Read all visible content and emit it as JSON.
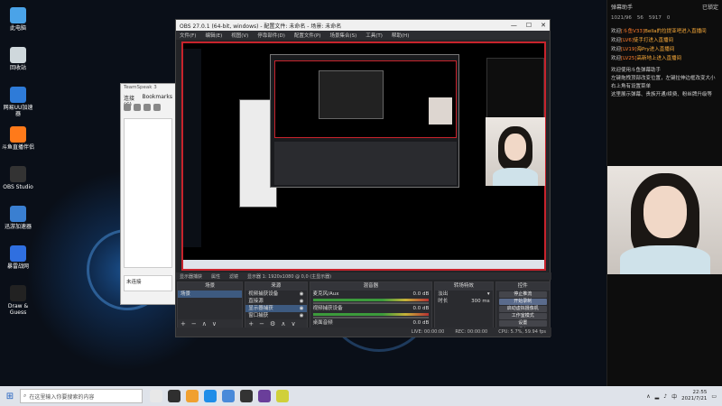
{
  "desktop": {
    "icons": [
      {
        "name": "此电脑",
        "color": "#4aa3e8"
      },
      {
        "name": "回收站",
        "color": "#cfd8dc"
      },
      {
        "name": "网易UU加速器",
        "color": "#2e7bd8"
      },
      {
        "name": "斗鱼直播伴侣",
        "color": "#ff7a1a"
      },
      {
        "name": "OBS Studio",
        "color": "#333333"
      },
      {
        "name": "迅游加速器",
        "color": "#3a7fd1"
      },
      {
        "name": "暴雷战网",
        "color": "#2f6fe0"
      },
      {
        "name": "Draw & Guess",
        "color": "#222222"
      }
    ]
  },
  "bg_window": {
    "title": "TeamSpeak 3",
    "menu": [
      "连接(C)",
      "Bookmarks"
    ],
    "footer_text": "未连接"
  },
  "obs": {
    "title": "OBS 27.0.1 (64-bit, windows) - 配置文件: 未命名 - 场景: 未命名",
    "window_controls": [
      "—",
      "☐",
      "✕"
    ],
    "menu": [
      "文件(F)",
      "编辑(E)",
      "视图(V)",
      "停靠部件(D)",
      "配置文件(P)",
      "场景集合(S)",
      "工具(T)",
      "帮助(H)"
    ],
    "status_line": [
      "显示器捕获",
      "属性",
      "滤镜",
      "显示器 1: 1920x1080 @ 0,0 (主显示器)"
    ],
    "docks": {
      "scenes": {
        "title": "场景",
        "items": [
          "场景"
        ]
      },
      "sources": {
        "title": "来源",
        "items": [
          "视频捕获设备",
          "直接源",
          "显示器捕获",
          "窗口捕获",
          "文本 (GDI+)",
          "图像 2"
        ]
      },
      "mixer": {
        "title": "混音器",
        "channels": [
          {
            "name": "麦克风/Aux",
            "db": "0.0 dB"
          },
          {
            "name": "视频捕获设备",
            "db": "0.0 dB"
          },
          {
            "name": "桌面音频",
            "db": "0.0 dB"
          }
        ]
      },
      "transitions": {
        "title": "转场特效",
        "type": "淡出",
        "duration_label": "时长",
        "duration": "300 ms"
      },
      "controls": {
        "title": "控件",
        "buttons": [
          "停止推流",
          "开始录制",
          "启动虚拟摄像机",
          "工作室模式",
          "设置",
          "退出"
        ]
      }
    },
    "status": {
      "live": "LIVE: 00:00:00",
      "rec": "REC: 00:00:00",
      "cpu": "CPU: 5.7%, 59.94 fps"
    }
  },
  "chat": {
    "header_title": "弹幕助手",
    "header_right": "已锁定",
    "stats": [
      "1021/96",
      "56",
      "5917",
      "0"
    ],
    "messages": [
      {
        "pre": "欢迎",
        "lvl": "[斗鱼V33]",
        "post": "Bella的拉提亚吧进入直播间"
      },
      {
        "pre": "欢迎",
        "lvl": "[LV6]",
        "post": "徒手打进入直播间"
      },
      {
        "pre": "欢迎",
        "lvl": "[LV19]",
        "post": "海Pry进入直播间"
      },
      {
        "pre": "欢迎",
        "lvl": "[LV25]",
        "post": "高新地上进入直播间"
      }
    ],
    "notes": [
      "欢迎使用斗鱼弹幕助手",
      "左键拖拽顶部改变位置，左键拉伸边框改变大小",
      "右上角有设置菜单",
      "这里展示弹幕、贵族开通/续费、粉丝牌升级等"
    ]
  },
  "taskbar": {
    "search_placeholder": "在这里输入你要搜索的内容",
    "apps": [
      "#e8e8e8",
      "#2f2f2f",
      "#f0a030",
      "#1f8de8",
      "#4a8ad9",
      "#333333",
      "#6a3e9a",
      "#d0d03a"
    ],
    "tray_lang": "中",
    "time": "22:55",
    "date": "2021/7/21"
  }
}
